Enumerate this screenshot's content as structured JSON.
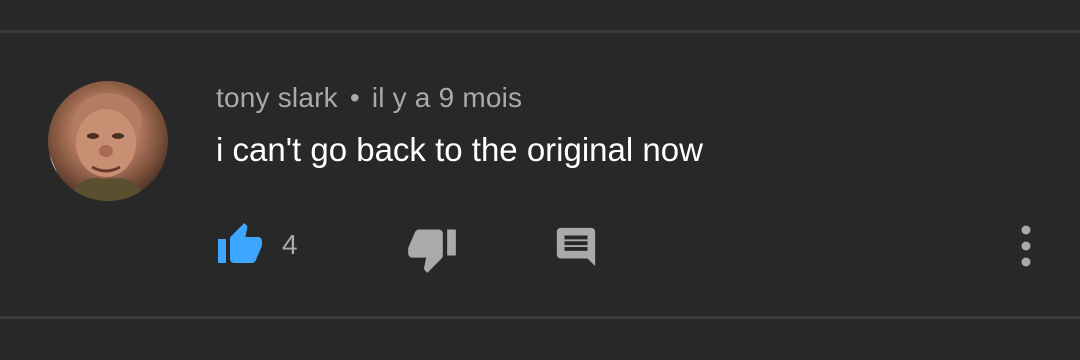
{
  "comment": {
    "author": "tony slark",
    "separator": "•",
    "timestamp": "il y a 9 mois",
    "text": "i can't go back to the original now",
    "like_count": "4"
  },
  "icons": {
    "avatar": "user-avatar-photo",
    "like": "thumb-up-icon",
    "dislike": "thumb-down-icon",
    "reply": "comment-reply-icon",
    "menu": "more-vertical-icon"
  },
  "colors": {
    "background": "#282828",
    "divider": "#3a3a3a",
    "like_active": "#3ea6ff",
    "icon_inactive": "#aaaaaa",
    "text_primary": "#ffffff",
    "text_secondary": "#aaaaaa"
  }
}
